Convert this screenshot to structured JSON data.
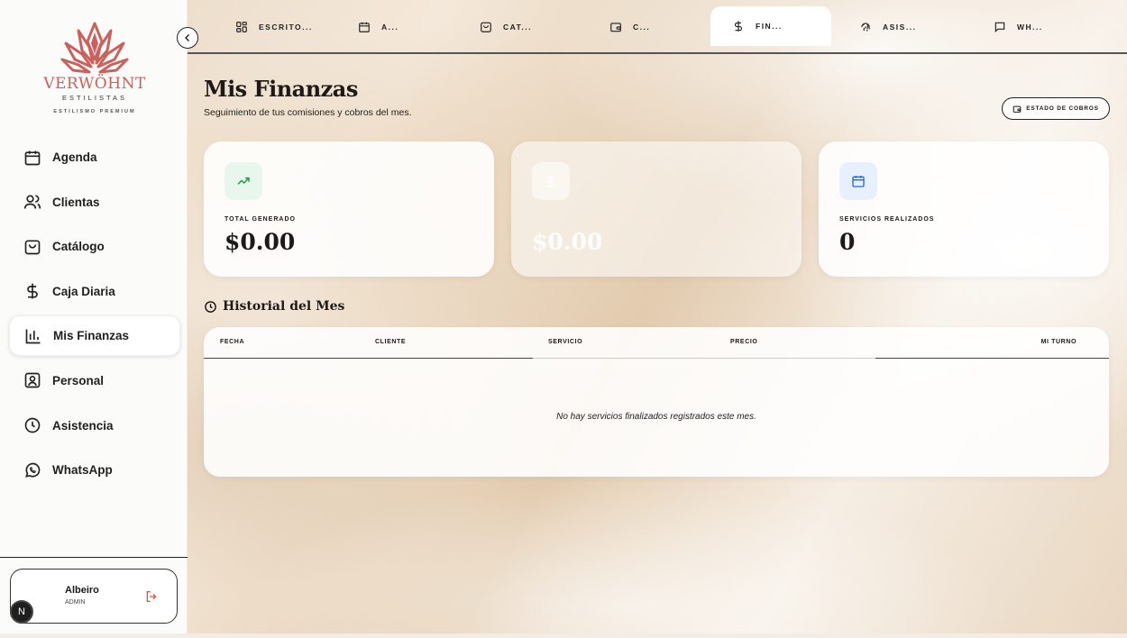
{
  "brand": {
    "name": "VERWÖHNT",
    "subtitle": "ESTILISTAS",
    "tagline": "ESTILISMO PREMIUM"
  },
  "sidebar": {
    "items": [
      {
        "label": "Agenda",
        "icon": "calendar-icon"
      },
      {
        "label": "Clientas",
        "icon": "users-icon"
      },
      {
        "label": "Catálogo",
        "icon": "shopping-bag-icon"
      },
      {
        "label": "Caja Diaria",
        "icon": "dollar-icon"
      },
      {
        "label": "Mis Finanzas",
        "icon": "bar-chart-icon",
        "active": true
      },
      {
        "label": "Personal",
        "icon": "person-card-icon"
      },
      {
        "label": "Asistencia",
        "icon": "clock-icon"
      },
      {
        "label": "WhatsApp",
        "icon": "whatsapp-icon"
      }
    ]
  },
  "user": {
    "name": "Albeiro",
    "role": "ADMIN",
    "avatar_initial": "N"
  },
  "tabs": [
    {
      "label": "ESCRITO...",
      "icon": "grid-icon"
    },
    {
      "label": "A...",
      "icon": "calendar-icon"
    },
    {
      "label": "CAT...",
      "icon": "shopping-bag-icon"
    },
    {
      "label": "C...",
      "icon": "wallet-icon"
    },
    {
      "label": "FIN...",
      "icon": "dollar-icon",
      "active": true
    },
    {
      "label": "ASIS...",
      "icon": "fingerprint-icon"
    },
    {
      "label": "WH...",
      "icon": "message-icon"
    }
  ],
  "main": {
    "title": "Mis Finanzas",
    "subtitle": "Seguimiento de tus comisiones y cobros del mes.",
    "status_button": "ESTADO DE COBROS"
  },
  "cards": [
    {
      "label": "TOTAL GENERADO",
      "value": "$0.00",
      "icon": "trending-up-icon",
      "accent": "#16a34a"
    },
    {
      "label": "",
      "value": "$0.00",
      "tag": "",
      "icon": "dollar-icon"
    },
    {
      "label": "SERVICIOS REALIZADOS",
      "value": "0",
      "icon": "calendar-icon",
      "accent": "#2563eb"
    }
  ],
  "history": {
    "title": "Historial del Mes",
    "columns": [
      "FECHA",
      "CLIENTE",
      "SERVICIO",
      "PRECIO",
      "MI TURNO"
    ],
    "empty_message": "No hay servicios finalizados registrados este mes."
  },
  "colors": {
    "brand": "#c9615c",
    "sidebar_bg": "#fbfbfa",
    "text": "#1c1917"
  }
}
